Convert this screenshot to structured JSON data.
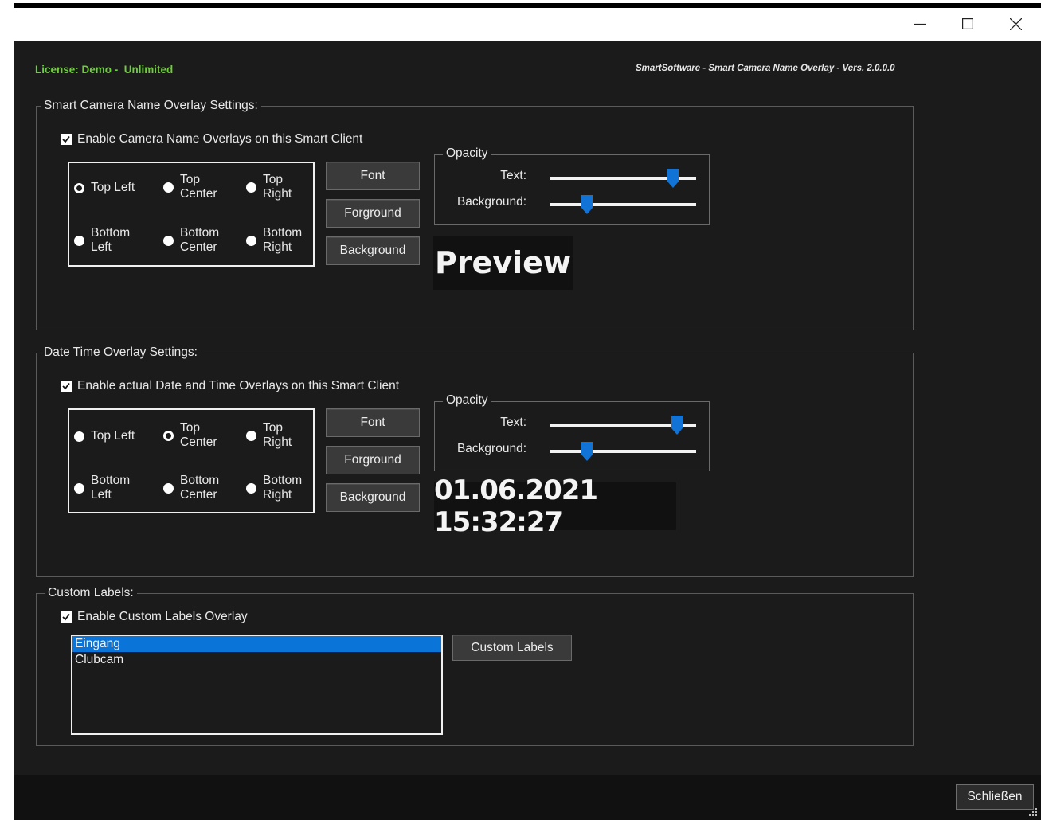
{
  "window": {
    "controls": {
      "minimize_icon": "minimize-icon",
      "maximize_icon": "maximize-icon",
      "close_icon": "close-icon"
    }
  },
  "header": {
    "license_label": "License: Demo -",
    "license_value": "Unlimited",
    "app_info": "SmartSoftware - Smart Camera Name Overlay -  Vers. 2.0.0.0",
    "license_color": "#6ecf3a"
  },
  "camera_name": {
    "legend": "Smart Camera Name Overlay Settings:",
    "enable_label": "Enable Camera Name Overlays on this Smart Client",
    "enabled": true,
    "positions": {
      "top_left": "Top Left",
      "top_center": "Top\nCenter",
      "top_right": "Top\nRight",
      "bottom_left": "Bottom\nLeft",
      "bottom_center": "Bottom\nCenter",
      "bottom_right": "Bottom\nRight"
    },
    "selected_position": "Top Left",
    "buttons": {
      "font": "Font",
      "foreground": "Forground",
      "background": "Background"
    },
    "opacity": {
      "legend": "Opacity",
      "text_label": "Text:",
      "background_label": "Background:",
      "text_value": 0.87,
      "background_value": 0.23
    },
    "preview_text": "Preview"
  },
  "date_time": {
    "legend": "Date Time Overlay Settings:",
    "enable_label": "Enable actual Date and Time Overlays on this Smart Client",
    "enabled": true,
    "positions": {
      "top_left": "Top Left",
      "top_center": "Top\nCenter",
      "top_right": "Top\nRight",
      "bottom_left": "Bottom\nLeft",
      "bottom_center": "Bottom\nCenter",
      "bottom_right": "Bottom\nRight"
    },
    "selected_position": "Top Center",
    "buttons": {
      "font": "Font",
      "foreground": "Forground",
      "background": "Background"
    },
    "opacity": {
      "legend": "Opacity",
      "text_label": "Text:",
      "background_label": "Background:",
      "text_value": 0.9,
      "background_value": 0.23
    },
    "preview_text": "01.06.2021 15:32:27"
  },
  "custom_labels": {
    "legend": "Custom Labels:",
    "enable_label": "Enable Custom Labels Overlay",
    "enabled": true,
    "items": [
      "Eingang",
      "Clubcam"
    ],
    "selected_item": "Eingang",
    "button_label": "Custom Labels"
  },
  "footer": {
    "close_label": "Schließen"
  },
  "colors": {
    "accent": "#0a74d8",
    "slider_thumb": "#1273d6",
    "background": "#1b1b1b"
  }
}
